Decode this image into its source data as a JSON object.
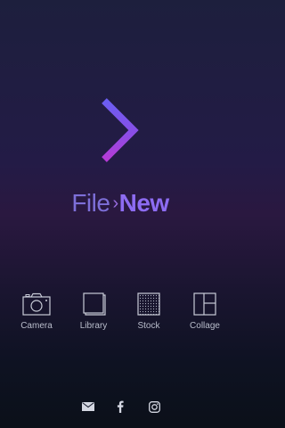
{
  "brand": {
    "wordmark_file": "File",
    "wordmark_sep": "›",
    "wordmark_new": "New",
    "logo_icon": "chevron-right-gradient"
  },
  "actions": [
    {
      "label": "Camera",
      "icon": "camera-icon"
    },
    {
      "label": "Library",
      "icon": "library-icon"
    },
    {
      "label": "Stock",
      "icon": "stock-icon"
    },
    {
      "label": "Collage",
      "icon": "collage-icon"
    }
  ],
  "social": [
    {
      "icon": "mail-icon"
    },
    {
      "icon": "facebook-icon"
    },
    {
      "icon": "instagram-icon"
    }
  ],
  "colors": {
    "accent_purple": "#8d6cf2",
    "logo_top": "#6f5cf0",
    "logo_bottom": "#b03bd6"
  }
}
